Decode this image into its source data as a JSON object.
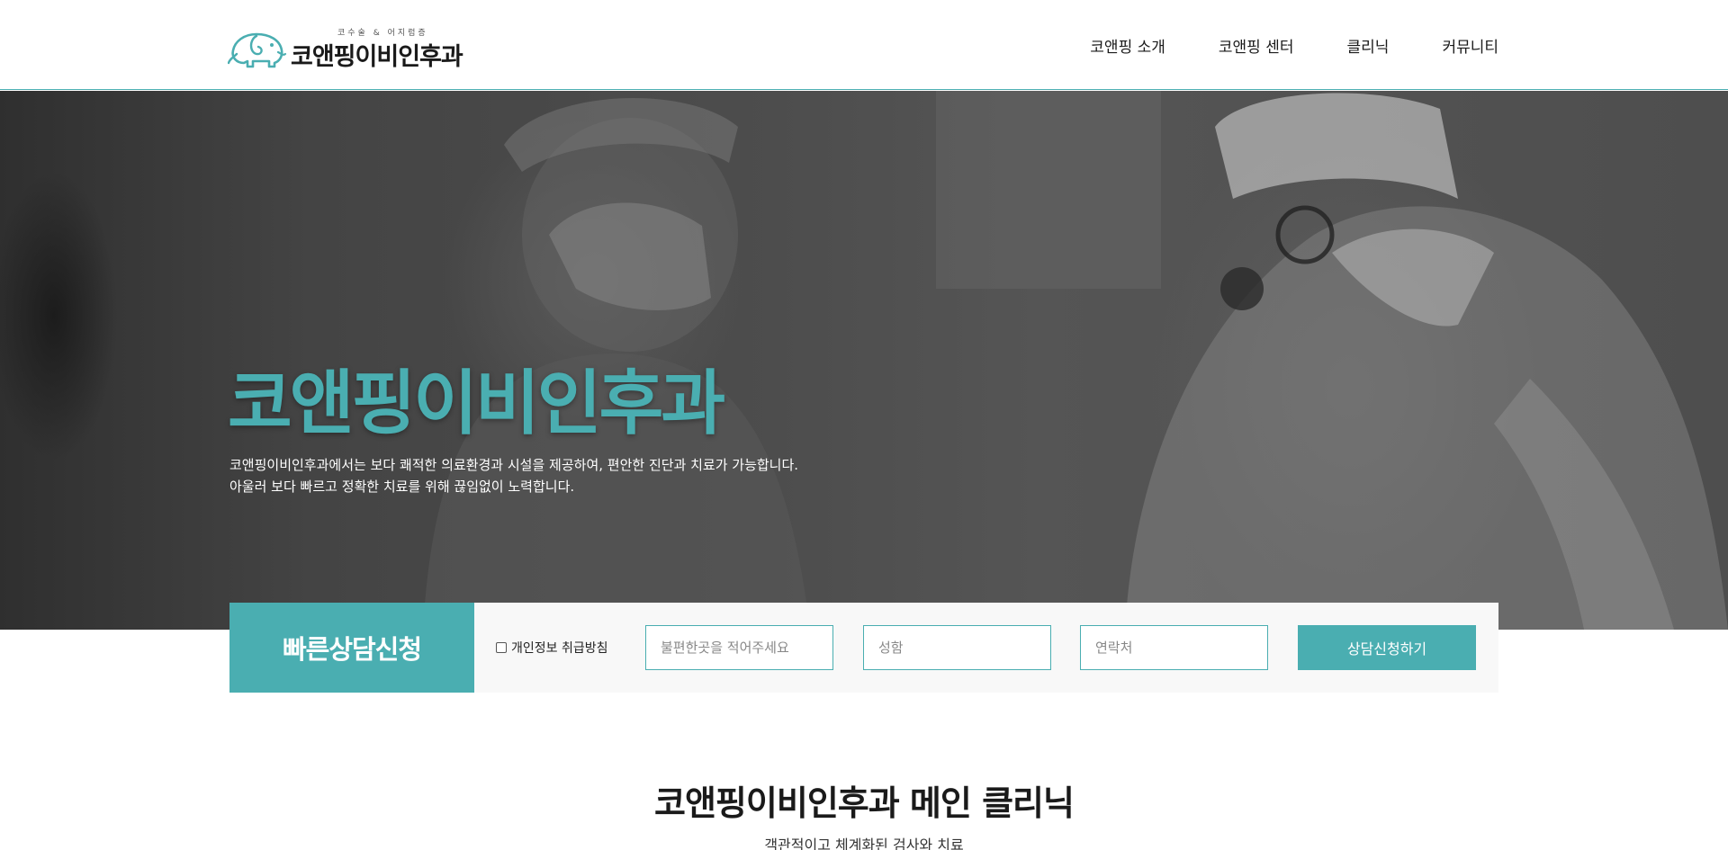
{
  "header": {
    "logo_subtitle": "코수술 & 어지럼증",
    "logo_title": "코앤핑이비인후과",
    "nav": [
      {
        "label": "코앤핑 소개"
      },
      {
        "label": "코앤핑 센터"
      },
      {
        "label": "클리닉"
      },
      {
        "label": "커뮤니티"
      }
    ]
  },
  "hero": {
    "title": "코앤핑이비인후과",
    "desc_line1": "코앤핑이비인후과에서는 보다 쾌적한 의료환경과 시설을 제공하여, 편안한 진단과 치료가 가능합니다.",
    "desc_line2": "아울러 보다 빠르고 정확한 치료를 위해 끊임없이 노력합니다."
  },
  "consult": {
    "label": "빠른상담신청",
    "privacy_label": "개인정보 취급방침",
    "symptom_placeholder": "불편한곳을 적어주세요",
    "name_placeholder": "성함",
    "phone_placeholder": "연락처",
    "submit_label": "상담신청하기"
  },
  "main": {
    "section_title": "코앤핑이비인후과 메인 클리닉",
    "section_subtitle": "객관적이고 체계화된 검사와 치료"
  },
  "colors": {
    "accent": "#4aaeb1",
    "hero_bg": "#4d4d4d"
  },
  "icons": {
    "logo": "elephant-logo-icon"
  }
}
